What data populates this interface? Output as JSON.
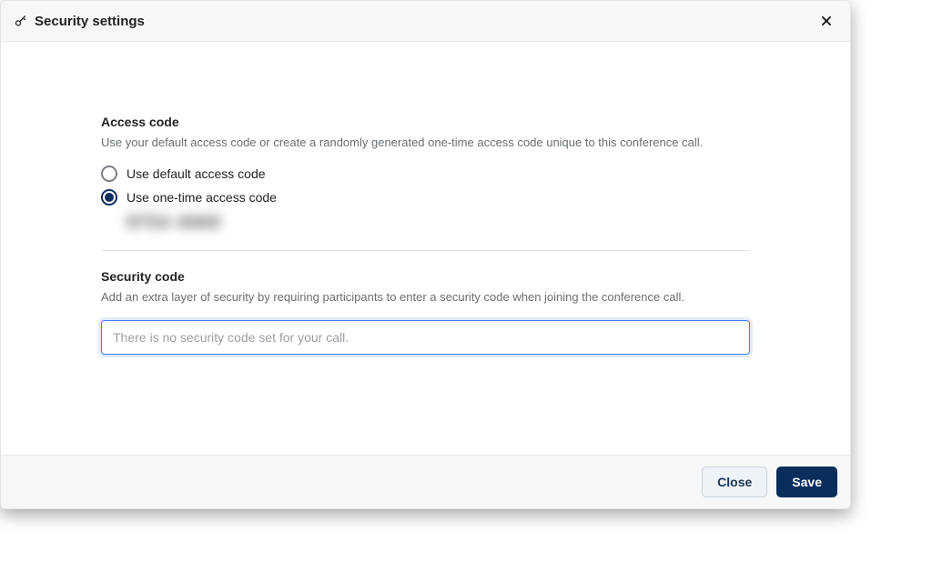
{
  "header": {
    "title": "Security settings"
  },
  "access": {
    "title": "Access code",
    "description": "Use your default access code or create a randomly generated one-time access code unique to this conference call.",
    "option_default": "Use default access code",
    "option_onetime": "Use one-time access code",
    "selected": "onetime",
    "onetime_code_display": "9754 4069"
  },
  "security": {
    "title": "Security code",
    "description": "Add an extra layer of security by requiring participants to enter a security code when joining the conference call.",
    "placeholder": "There is no security code set for your call.",
    "value": ""
  },
  "footer": {
    "close_label": "Close",
    "save_label": "Save"
  }
}
